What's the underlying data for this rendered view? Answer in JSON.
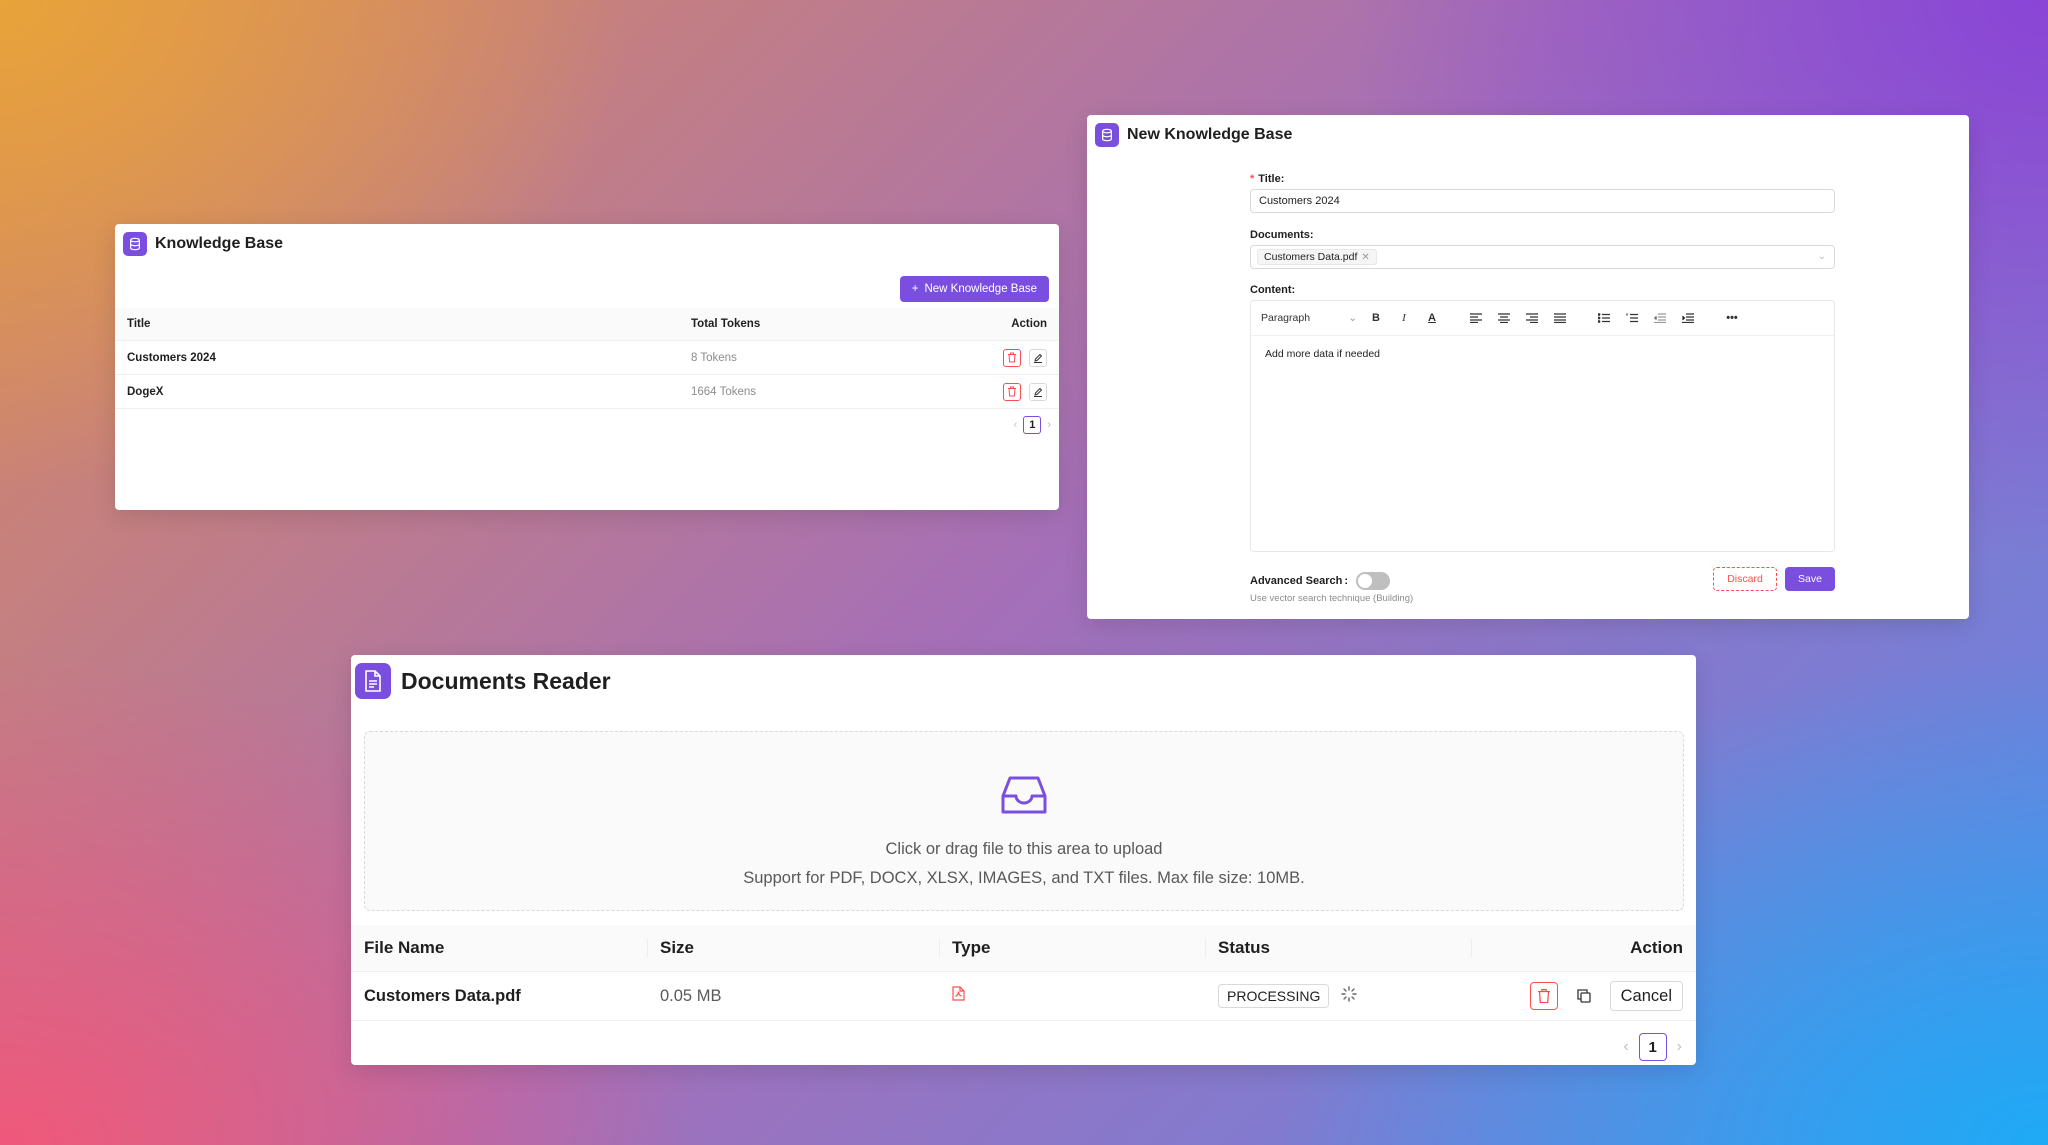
{
  "knowledge_base": {
    "title": "Knowledge Base",
    "new_button": "New Knowledge Base",
    "columns": {
      "title": "Title",
      "tokens": "Total Tokens",
      "action": "Action"
    },
    "rows": [
      {
        "title": "Customers 2024",
        "tokens": "8 Tokens"
      },
      {
        "title": "DogeX",
        "tokens": "1664 Tokens"
      }
    ],
    "page": "1"
  },
  "new_kb": {
    "title": "New Knowledge Base",
    "title_label": "Title:",
    "title_required": "*",
    "title_value": "Customers 2024",
    "documents_label": "Documents:",
    "document_tag": "Customers Data.pdf",
    "content_label": "Content:",
    "paragraph_select": "Paragraph",
    "content_text": "Add more data if needed",
    "advanced_label": "Advanced Search",
    "advanced_help": "Use vector search technique (Building)",
    "discard": "Discard",
    "save": "Save"
  },
  "documents_reader": {
    "title": "Documents Reader",
    "upload_line1": "Click or drag file to this area to upload",
    "upload_line2": "Support for PDF, DOCX, XLSX, IMAGES, and TXT files. Max file size: 10MB.",
    "columns": {
      "file": "File Name",
      "size": "Size",
      "type": "Type",
      "status": "Status",
      "action": "Action"
    },
    "rows": [
      {
        "file": "Customers Data.pdf",
        "size": "0.05 MB",
        "type_icon": "pdf-file-icon",
        "status": "PROCESSING",
        "cancel": "Cancel"
      }
    ],
    "page": "1"
  },
  "colors": {
    "accent": "#7a4fe0",
    "danger": "#ff4d4f"
  }
}
